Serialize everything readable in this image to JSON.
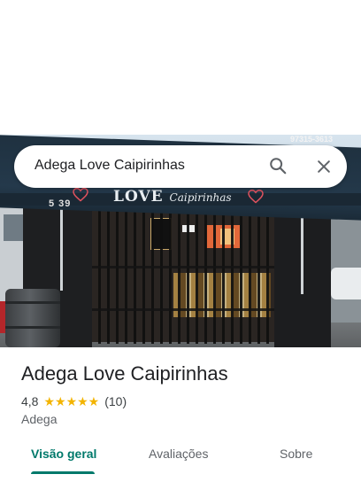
{
  "search": {
    "query": "Adega Love Caipirinhas",
    "search_icon": "search-icon",
    "close_icon": "close-icon"
  },
  "photo": {
    "awning_brand": "LOVE",
    "awning_brand_script": "Caipirinhas",
    "awning_phone": "97315-3613",
    "house_number": "5 39"
  },
  "place": {
    "title": "Adega Love Caipirinhas",
    "rating": "4,8",
    "stars": "★★★★★",
    "review_count": "(10)",
    "category": "Adega"
  },
  "tabs": [
    {
      "label": "Visão geral",
      "selected": true
    },
    {
      "label": "Avaliações",
      "selected": false
    },
    {
      "label": "Sobre",
      "selected": false
    }
  ],
  "colors": {
    "accent": "#00796b",
    "star": "#f3b400",
    "text_primary": "#202124",
    "text_secondary": "#5f6368"
  }
}
